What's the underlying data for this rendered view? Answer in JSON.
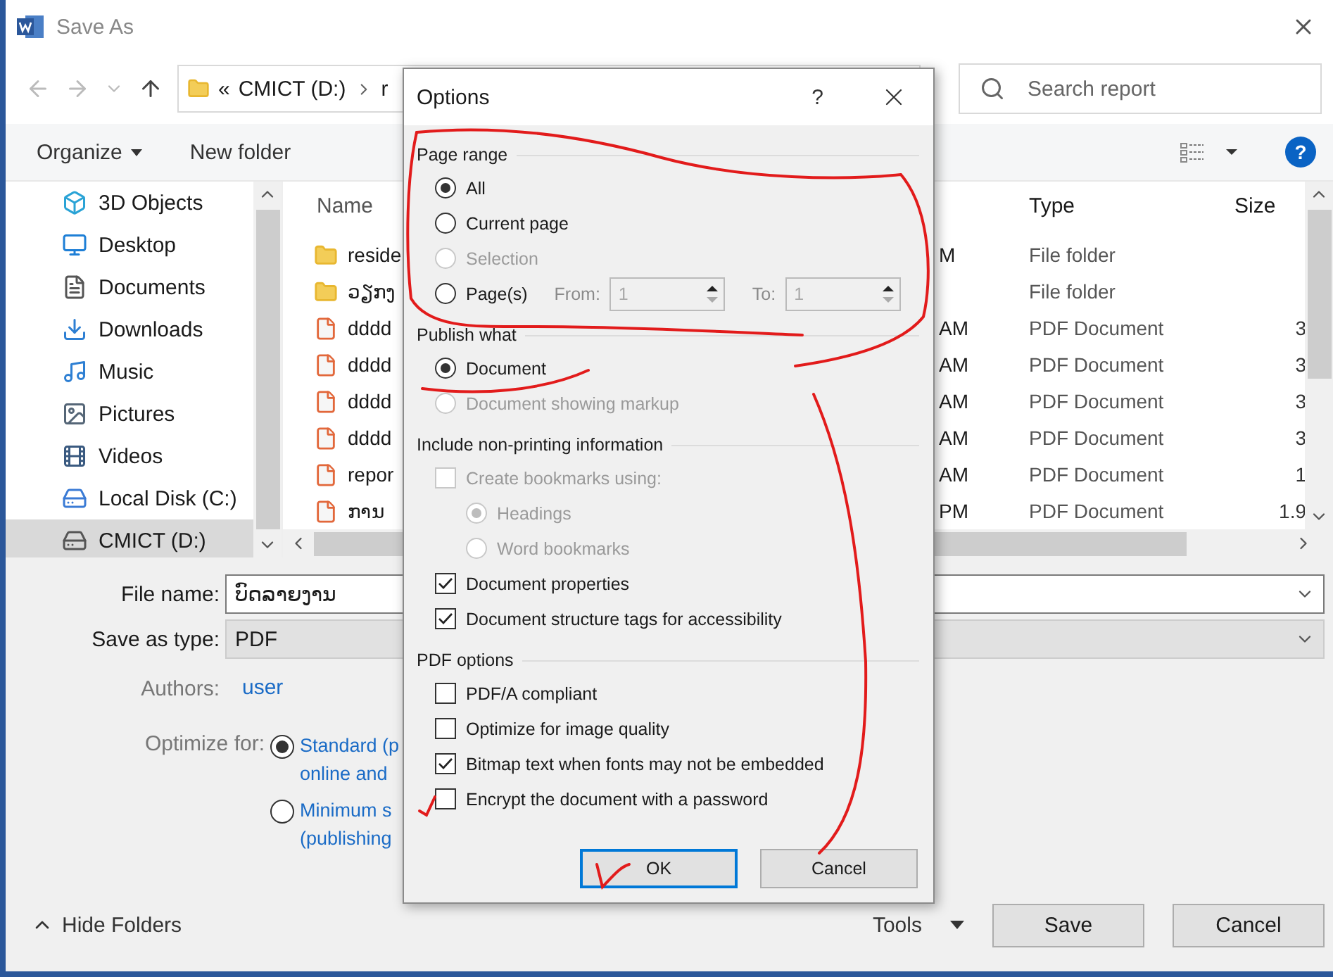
{
  "window": {
    "title": "Save As"
  },
  "address": {
    "prefix": "«",
    "crumbs": [
      "CMICT (D:)",
      "r"
    ]
  },
  "search": {
    "placeholder": "Search report"
  },
  "toolbar": {
    "organize": "Organize",
    "new_folder": "New folder",
    "help": "?"
  },
  "sidebar": {
    "items": [
      {
        "label": "3D Objects",
        "kind": "cube",
        "selected": false
      },
      {
        "label": "Desktop",
        "kind": "desktop",
        "selected": false
      },
      {
        "label": "Documents",
        "kind": "documents",
        "selected": false
      },
      {
        "label": "Downloads",
        "kind": "downloads",
        "selected": false
      },
      {
        "label": "Music",
        "kind": "music",
        "selected": false
      },
      {
        "label": "Pictures",
        "kind": "pictures",
        "selected": false
      },
      {
        "label": "Videos",
        "kind": "videos",
        "selected": false
      },
      {
        "label": "Local Disk (C:)",
        "kind": "disk",
        "selected": false
      },
      {
        "label": "CMICT (D:)",
        "kind": "drive",
        "selected": true
      }
    ]
  },
  "files": {
    "columns": [
      "Name",
      "Type",
      "Size"
    ],
    "rows": [
      {
        "kind": "folder",
        "name": "reside",
        "date": "M",
        "type": "File folder"
      },
      {
        "kind": "folder",
        "name": "ວຽກງ",
        "type": "File folder"
      },
      {
        "kind": "pdf",
        "name": "dddd",
        "date": "AM",
        "type": "PDF Document",
        "size": "3"
      },
      {
        "kind": "pdf",
        "name": "dddd",
        "date": "AM",
        "type": "PDF Document",
        "size": "3"
      },
      {
        "kind": "pdf",
        "name": "dddd",
        "date": "AM",
        "type": "PDF Document",
        "size": "3"
      },
      {
        "kind": "pdf",
        "name": "dddd",
        "date": "AM",
        "type": "PDF Document",
        "size": "3"
      },
      {
        "kind": "pdf",
        "name": "repor",
        "date": "AM",
        "type": "PDF Document",
        "size": "1"
      },
      {
        "kind": "pdf",
        "name": "ການ",
        "date": "PM",
        "type": "PDF Document",
        "size": "1.9"
      }
    ]
  },
  "form": {
    "file_name_label": "File name:",
    "file_name": "ບົດລາຍງານ",
    "type_label": "Save as type:",
    "type": "PDF",
    "authors_label": "Authors:",
    "authors": "user",
    "optimize_label": "Optimize for:",
    "optimize_options": [
      {
        "lines": [
          "Standard (p",
          "online and"
        ],
        "selected": true
      },
      {
        "lines": [
          "Minimum s",
          "(publishing"
        ],
        "selected": false
      }
    ]
  },
  "footer": {
    "hide_folders": "Hide Folders",
    "tools": "Tools",
    "buttons": [
      "Save",
      "Cancel"
    ]
  },
  "dialog": {
    "title": "Options",
    "help": "?",
    "sections": [
      {
        "title": "Page range",
        "items": [
          {
            "kind": "radio",
            "label": "All",
            "selected": true,
            "disabled": false
          },
          {
            "kind": "radio",
            "label": "Current page",
            "selected": false,
            "disabled": false
          },
          {
            "kind": "radio",
            "label": "Selection",
            "selected": false,
            "disabled": true
          },
          {
            "kind": "radio",
            "label": "Page(s)",
            "selected": false,
            "disabled": false,
            "range": {
              "from_label": "From:",
              "from": "1",
              "to_label": "To:",
              "to": "1",
              "disabled": true
            }
          }
        ]
      },
      {
        "title": "Publish what",
        "items": [
          {
            "kind": "radio",
            "label": "Document",
            "selected": true,
            "disabled": false
          },
          {
            "kind": "radio",
            "label": "Document showing markup",
            "selected": false,
            "disabled": true
          }
        ]
      },
      {
        "title": "Include non-printing information",
        "items": [
          {
            "kind": "checkbox",
            "label": "Create bookmarks using:",
            "checked": false,
            "disabled": true,
            "children": [
              {
                "kind": "radio",
                "label": "Headings",
                "selected": true,
                "disabled": true
              },
              {
                "kind": "radio",
                "label": "Word bookmarks",
                "selected": false,
                "disabled": true
              }
            ]
          },
          {
            "kind": "checkbox",
            "label": "Document properties",
            "checked": true,
            "disabled": false
          },
          {
            "kind": "checkbox",
            "label": "Document structure tags for accessibility",
            "checked": true,
            "disabled": false
          }
        ]
      },
      {
        "title": "PDF options",
        "items": [
          {
            "kind": "checkbox",
            "label": "PDF/A compliant",
            "checked": false,
            "disabled": false
          },
          {
            "kind": "checkbox",
            "label": "Optimize for image quality",
            "checked": false,
            "disabled": false
          },
          {
            "kind": "checkbox",
            "label": "Bitmap text when fonts may not be embedded",
            "checked": true,
            "disabled": false
          },
          {
            "kind": "checkbox",
            "label": "Encrypt the document with a password",
            "checked": false,
            "disabled": false
          }
        ]
      }
    ],
    "buttons": [
      {
        "label": "OK",
        "default": true
      },
      {
        "label": "Cancel",
        "default": false
      }
    ]
  }
}
